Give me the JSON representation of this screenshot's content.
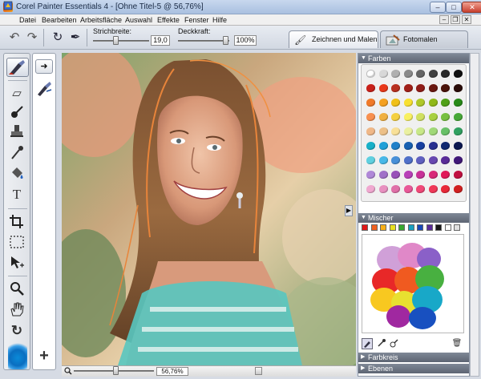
{
  "window": {
    "title": "Corel Painter Essentials 4 - [Ohne Titel-5 @ 56,76%]",
    "minimize_glyph": "‒",
    "maximize_glyph": "□",
    "close_glyph": "✕"
  },
  "menu": {
    "items": [
      "Datei",
      "Bearbeiten",
      "Arbeitsfläche",
      "Auswahl",
      "Effekte",
      "Fenster",
      "Hilfe"
    ],
    "mdi_minimize": "‒",
    "mdi_restore": "❐",
    "mdi_close": "✕"
  },
  "propbar": {
    "brush_width_label": "Strichbreite:",
    "brush_width_value": "19,0",
    "opacity_label": "Deckkraft:",
    "opacity_value": "100%"
  },
  "mode_tabs": {
    "draw_label": "Zeichnen und Malen",
    "photo_label": "Fotomalen"
  },
  "status": {
    "zoom_value": "56,76%"
  },
  "panels": {
    "colors_title": "Farben",
    "mixer_title": "Mischer",
    "color_wheel_title": "Farbkreis",
    "layers_title": "Ebenen"
  },
  "colors": {
    "swatch_rows": [
      [
        "#ffffff",
        "#d8d8d8",
        "#b0b0b0",
        "#8a8a8a",
        "#646464",
        "#404040",
        "#282828",
        "#101010"
      ],
      [
        "#c8201a",
        "#e8381a",
        "#b83020",
        "#a02018",
        "#901c18",
        "#6a1810",
        "#4a1208",
        "#2a0c08"
      ],
      [
        "#f07a2a",
        "#f4a020",
        "#f0c018",
        "#f8e030",
        "#b0c828",
        "#90b818",
        "#50a018",
        "#288a18"
      ],
      [
        "#f89050",
        "#f0b040",
        "#f4d040",
        "#f8f060",
        "#d0e060",
        "#a8d040",
        "#78c040",
        "#48a838"
      ],
      [
        "#f0b888",
        "#ecc088",
        "#f8e098",
        "#eaf0a0",
        "#c8e888",
        "#a0d878",
        "#68c068",
        "#30a060"
      ],
      [
        "#18b0c8",
        "#20a0d8",
        "#2080c8",
        "#1860b0",
        "#1840a0",
        "#283090",
        "#102870",
        "#0c1850"
      ],
      [
        "#60d0e0",
        "#48b8e8",
        "#4890d8",
        "#5070c8",
        "#6060c0",
        "#6848b0",
        "#5a2c98",
        "#401878"
      ],
      [
        "#b088d8",
        "#a070c8",
        "#9850b8",
        "#b840b8",
        "#c83098",
        "#d82878",
        "#e01858",
        "#c01040"
      ],
      [
        "#f0a8d0",
        "#e890c0",
        "#e070a8",
        "#e85898",
        "#f04878",
        "#f03858",
        "#e82838",
        "#d02020"
      ]
    ]
  },
  "mixer": {
    "swatches": [
      "#e01818",
      "#f06020",
      "#f8b018",
      "#e8e020",
      "#38a830",
      "#18a0c0",
      "#1848b8",
      "#5a2c98",
      "#181818",
      "#ffffff",
      "#e0e0e0"
    ]
  },
  "icons": {
    "undo": "↶",
    "redo": "↷",
    "rotate": "↻",
    "brush": "🖌",
    "eraser": "▱",
    "dropper": "💧",
    "stamp": "⊥",
    "pen": "✒",
    "fill": "◆",
    "text": "T",
    "crop": "⌗",
    "select": "⬚",
    "move": "✥",
    "zoom": "🔍",
    "hand": "✋",
    "rotate_page": "↻",
    "arrow_right": "➜",
    "plus": "+",
    "trash": "🗑",
    "collapse": "▶"
  }
}
